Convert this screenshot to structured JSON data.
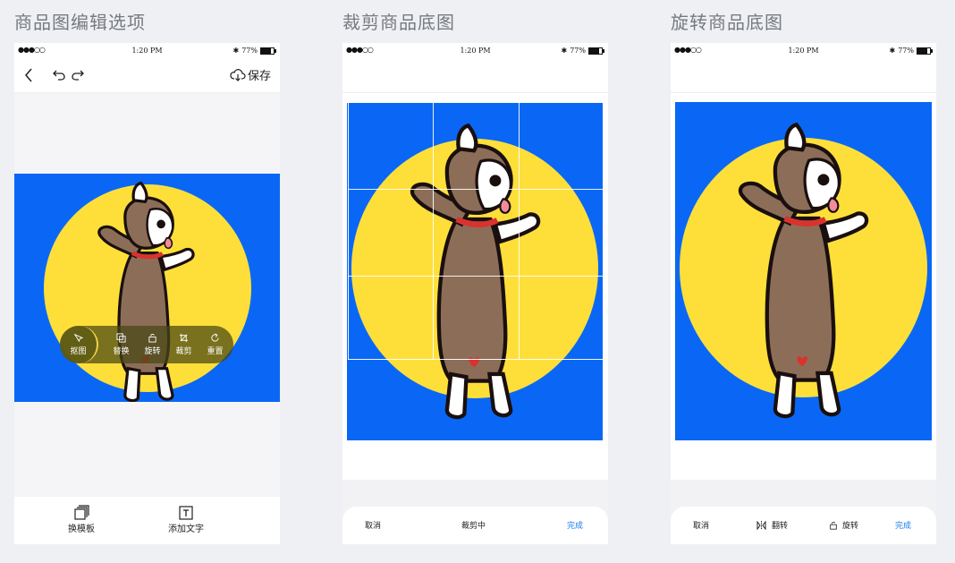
{
  "sections": [
    {
      "title": "商品图编辑选项"
    },
    {
      "title": "裁剪商品底图"
    },
    {
      "title": "旋转商品底图"
    }
  ],
  "statusbar": {
    "signal": "●●●○○",
    "time": "1:20 PM",
    "battery": "77%",
    "battery_level": 0.77
  },
  "editor": {
    "save_label": "保存",
    "tools": [
      {
        "label": "抠图",
        "icon": "cutout-icon",
        "active": true
      },
      {
        "label": "替换",
        "icon": "replace-icon"
      },
      {
        "label": "旋转",
        "icon": "rotate-icon"
      },
      {
        "label": "裁剪",
        "icon": "crop-icon"
      },
      {
        "label": "重置",
        "icon": "reset-icon"
      }
    ],
    "bottom": {
      "template_label": "换模板",
      "text_label": "添加文字"
    }
  },
  "crop": {
    "cancel": "取消",
    "status": "裁剪中",
    "done": "完成"
  },
  "rotate": {
    "cancel": "取消",
    "flip": "翻转",
    "rotate": "旋转",
    "done": "完成"
  },
  "colors": {
    "background": "#0a67f5",
    "sun": "#fedf3a",
    "dog": "#8c6e58",
    "accent": "#1a7cf0"
  }
}
